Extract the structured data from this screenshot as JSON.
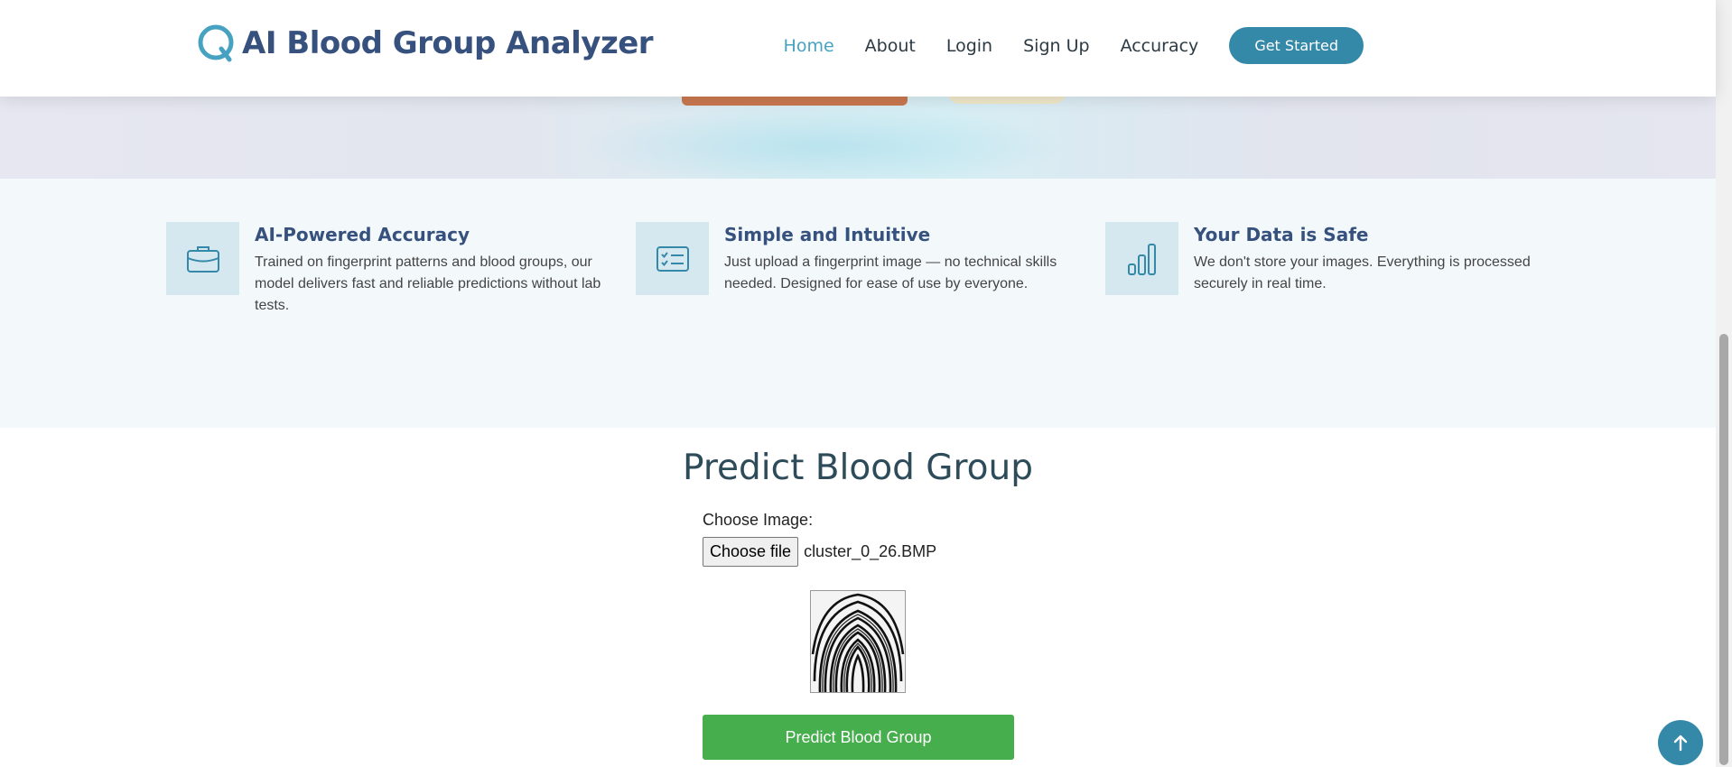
{
  "header": {
    "brand": "AI Blood Group Analyzer",
    "nav": [
      {
        "label": "Home",
        "active": true
      },
      {
        "label": "About",
        "active": false
      },
      {
        "label": "Login",
        "active": false
      },
      {
        "label": "Sign Up",
        "active": false
      },
      {
        "label": "Accuracy",
        "active": false
      }
    ],
    "cta_label": "Get Started"
  },
  "features": [
    {
      "icon": "briefcase-icon",
      "title": "AI-Powered Accuracy",
      "desc": "Trained on fingerprint patterns and blood groups, our model delivers fast and reliable predictions without lab tests."
    },
    {
      "icon": "checklist-icon",
      "title": "Simple and Intuitive",
      "desc": "Just upload a fingerprint image — no technical skills needed. Designed for ease of use by everyone."
    },
    {
      "icon": "bar-chart-icon",
      "title": "Your Data is Safe",
      "desc": "We don't store your images. Everything is processed securely in real time."
    }
  ],
  "predict": {
    "title": "Predict Blood Group",
    "choose_label": "Choose Image:",
    "file_button": "Choose file",
    "file_name": "cluster_0_26.BMP",
    "submit_label": "Predict Blood Group"
  },
  "colors": {
    "brand": "#37517e",
    "accent": "#3589a8",
    "nav_active": "#47a2c2",
    "predict_button": "#46ae4d",
    "feature_bg": "#f3f9fb",
    "icon_box": "#d5e8f0"
  }
}
